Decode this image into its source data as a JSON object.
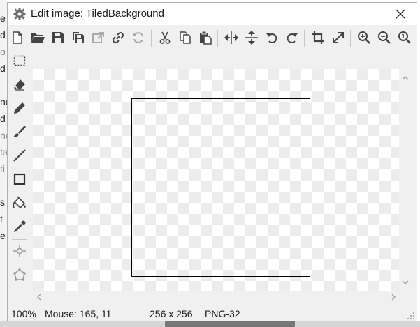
{
  "window": {
    "title": "Edit image: TiledBackground"
  },
  "background_app": {
    "left_fragments": [
      "e",
      "d",
      "o",
      "d",
      "nc",
      "d",
      "ne",
      "ta",
      "ti",
      "s",
      "t",
      "e"
    ]
  },
  "toolbar": {
    "buttons": [
      {
        "name": "new-icon",
        "label": "New"
      },
      {
        "name": "open-icon",
        "label": "Open"
      },
      {
        "name": "save-icon",
        "label": "Save"
      },
      {
        "name": "save-copy-icon",
        "label": "Save copy"
      },
      {
        "name": "export-icon",
        "label": "Export"
      },
      {
        "name": "link-icon",
        "label": "Link"
      },
      {
        "name": "refresh-icon",
        "label": "Refresh"
      },
      {
        "name": "cut-icon",
        "label": "Cut"
      },
      {
        "name": "copy-icon",
        "label": "Copy"
      },
      {
        "name": "paste-icon",
        "label": "Paste"
      },
      {
        "name": "flip-horizontal-icon",
        "label": "Flip horizontal"
      },
      {
        "name": "flip-vertical-icon",
        "label": "Flip vertical"
      },
      {
        "name": "rotate-left-icon",
        "label": "Rotate left"
      },
      {
        "name": "rotate-right-icon",
        "label": "Rotate right"
      },
      {
        "name": "crop-icon",
        "label": "Crop"
      },
      {
        "name": "resize-icon",
        "label": "Resize"
      },
      {
        "name": "zoom-in-icon",
        "label": "Zoom in"
      },
      {
        "name": "zoom-out-icon",
        "label": "Zoom out"
      },
      {
        "name": "zoom-actual-icon",
        "label": "Actual size"
      }
    ]
  },
  "tools": [
    {
      "name": "select-rectangle-icon"
    },
    {
      "name": "eraser-icon"
    },
    {
      "name": "pencil-icon"
    },
    {
      "name": "brush-icon"
    },
    {
      "name": "line-icon"
    },
    {
      "name": "rectangle-icon"
    },
    {
      "name": "fill-bucket-icon"
    },
    {
      "name": "eyedropper-icon"
    },
    {
      "name": "origin-point-icon"
    },
    {
      "name": "polygon-icon"
    }
  ],
  "canvas": {
    "image_size": "256 x 256"
  },
  "status": {
    "zoom": "100%",
    "mouse": "Mouse: 165, 11",
    "size": "256 x 256",
    "format": "PNG-32"
  },
  "colors": {
    "window_bg": "#f0f0f0",
    "titlebar_bg": "#ffffff",
    "checker_light": "#ffffff",
    "checker_dark": "#ececec",
    "icon": "#444444",
    "image_border": "#000000"
  }
}
